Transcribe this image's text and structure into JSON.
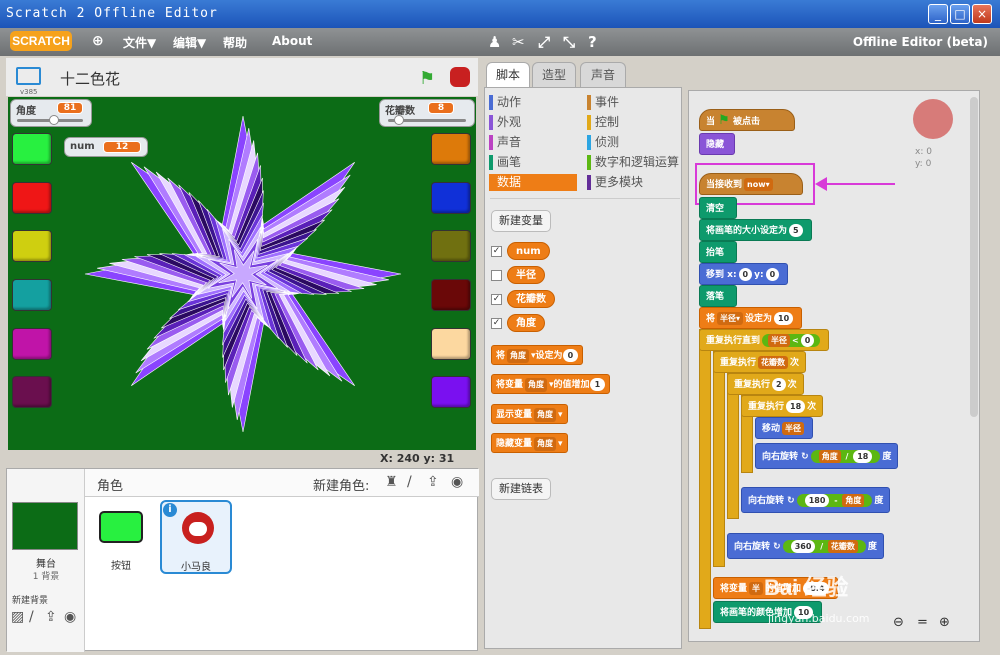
{
  "window": {
    "title": "Scratch 2 Offline Editor",
    "minimize": "_",
    "maximize": "□",
    "close": "×"
  },
  "menubar": {
    "logo": "SCRATCH",
    "items": [
      "文件▼",
      "编辑▼",
      "帮助",
      "About"
    ],
    "version_label": "Offline Editor (beta)"
  },
  "stage": {
    "version": "v385",
    "project_name": "十二色花",
    "coords": "X: 240  y: 31",
    "monitors": [
      {
        "label": "角度",
        "value": "81"
      },
      {
        "label": "花瓣数",
        "value": "8"
      },
      {
        "label": "num",
        "value": "12"
      }
    ],
    "left_swatches": [
      "#28f040",
      "#ef1616",
      "#cfcf10",
      "#14a0a0",
      "#c014a8",
      "#6a0f4e"
    ],
    "right_swatches": [
      "#dd7a0a",
      "#1030d8",
      "#707010",
      "#6a0808",
      "#fcd8a0",
      "#7a10f0"
    ]
  },
  "sprites": {
    "header": "角色",
    "new_sprite_label": "新建角色:",
    "stage_name": "舞台",
    "stage_sub": "1 背景",
    "new_backdrop": "新建背景",
    "items": [
      {
        "name": "按钮"
      },
      {
        "name": "小马良",
        "info": "i"
      }
    ]
  },
  "tabs": [
    {
      "label": "脚本"
    },
    {
      "label": "造型"
    },
    {
      "label": "声音"
    }
  ],
  "palette": {
    "categories": [
      {
        "label": "动作",
        "color": "#4a6cd4"
      },
      {
        "label": "事件",
        "color": "#c88330"
      },
      {
        "label": "外观",
        "color": "#8a55d7"
      },
      {
        "label": "控制",
        "color": "#e1a91a"
      },
      {
        "label": "声音",
        "color": "#bb42c3"
      },
      {
        "label": "侦测",
        "color": "#2ca5e2"
      },
      {
        "label": "画笔",
        "color": "#0e9a6c"
      },
      {
        "label": "数字和逻辑运算",
        "color": "#5cb712"
      },
      {
        "label": "数据",
        "color": "#ee7d16"
      },
      {
        "label": "更多模块",
        "color": "#632d99"
      }
    ],
    "new_variable": "新建变量",
    "new_list": "新建链表",
    "variables": [
      {
        "name": "num",
        "checked": "✓"
      },
      {
        "name": "半径",
        "checked": ""
      },
      {
        "name": "花瓣数",
        "checked": "✓"
      },
      {
        "name": "角度",
        "checked": "✓"
      }
    ],
    "blocks": {
      "set": [
        "将",
        "角度",
        "设定为",
        "0"
      ],
      "change": [
        "将变量",
        "角度",
        "的值增加",
        "1"
      ],
      "show": [
        "显示变量",
        "角度"
      ],
      "hide": [
        "隐藏变量",
        "角度"
      ]
    }
  },
  "script": {
    "flag_hat": [
      "当",
      "被点击"
    ],
    "hide": "隐藏",
    "recv": [
      "当接收到",
      "now"
    ],
    "clear": "清空",
    "pensize": [
      "将画笔的大小设定为",
      "5"
    ],
    "pendown": "抬笔",
    "goto": [
      "移到 x:",
      "0",
      "y:",
      "0"
    ],
    "penup": "落笔",
    "setr": [
      "将",
      "半径",
      "设定为",
      "10"
    ],
    "until": [
      "重复执行直到",
      "半径",
      "<",
      "0"
    ],
    "rep1": [
      "重复执行",
      "花瓣数",
      "次"
    ],
    "rep2": [
      "重复执行",
      "2",
      "次"
    ],
    "rep3": [
      "重复执行",
      "18",
      "次"
    ],
    "move": [
      "移动",
      "半径"
    ],
    "turn1": [
      "向右旋转",
      "角度",
      "/",
      "18",
      "度"
    ],
    "turn2": [
      "向右旋转",
      "180",
      "-",
      "角度",
      "度"
    ],
    "turn3": [
      "向右旋转",
      "360",
      "/",
      "花瓣数",
      "度"
    ],
    "chg": [
      "将变量",
      "半",
      "的值增加",
      "-0.4"
    ],
    "color": [
      "将画笔的颜色增加",
      "10"
    ],
    "sprite_xy": [
      "x: 0",
      "y: 0"
    ]
  },
  "watermark": {
    "brand": "Bai 经验",
    "url": "jingyan.baidu.com"
  }
}
